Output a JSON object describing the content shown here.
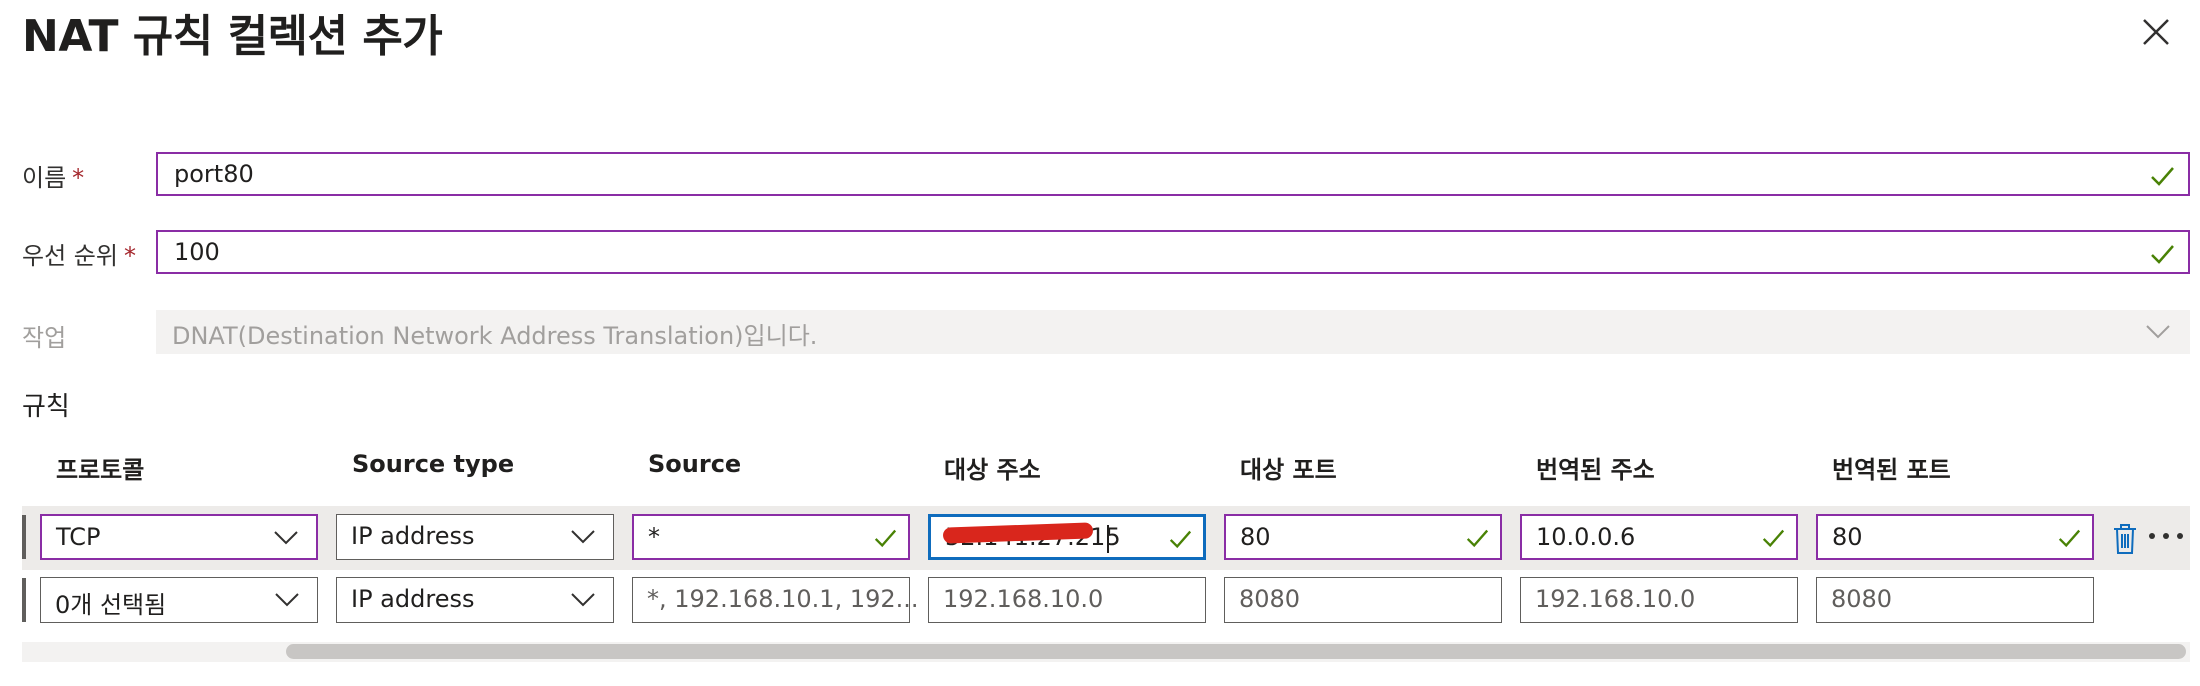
{
  "dialog": {
    "title": "NAT 규칙 컬렉션 추가",
    "close_icon": "close-icon"
  },
  "form": {
    "name": {
      "label": "이름",
      "required_mark": "*",
      "value": "port80"
    },
    "priority": {
      "label": "우선 순위",
      "required_mark": "*",
      "value": "100"
    },
    "action": {
      "label": "작업",
      "value": "DNAT(Destination Network Address Translation)입니다."
    }
  },
  "rules": {
    "section_label": "규칙",
    "columns": [
      "프로토콜",
      "Source type",
      "Source",
      "대상 주소",
      "대상 포트",
      "번역된 주소",
      "번역된 포트"
    ],
    "rows": [
      {
        "protocol": "TCP",
        "source_type": "IP address",
        "source": "*",
        "destination_address": "52.141.27.215",
        "destination_port": "80",
        "translated_address": "10.0.0.6",
        "translated_port": "80"
      },
      {
        "protocol": "0개 선택됨",
        "source_type": "IP address",
        "source": "*, 192.168.10.1, 192...",
        "destination_address": "192.168.10.0",
        "destination_port": "8080",
        "translated_address": "192.168.10.0",
        "translated_port": "8080"
      }
    ]
  },
  "colors": {
    "valid_border": "#8a2da5",
    "focus_border": "#0f6cbd",
    "check": "#498205",
    "delete_icon": "#0f6cbd"
  }
}
